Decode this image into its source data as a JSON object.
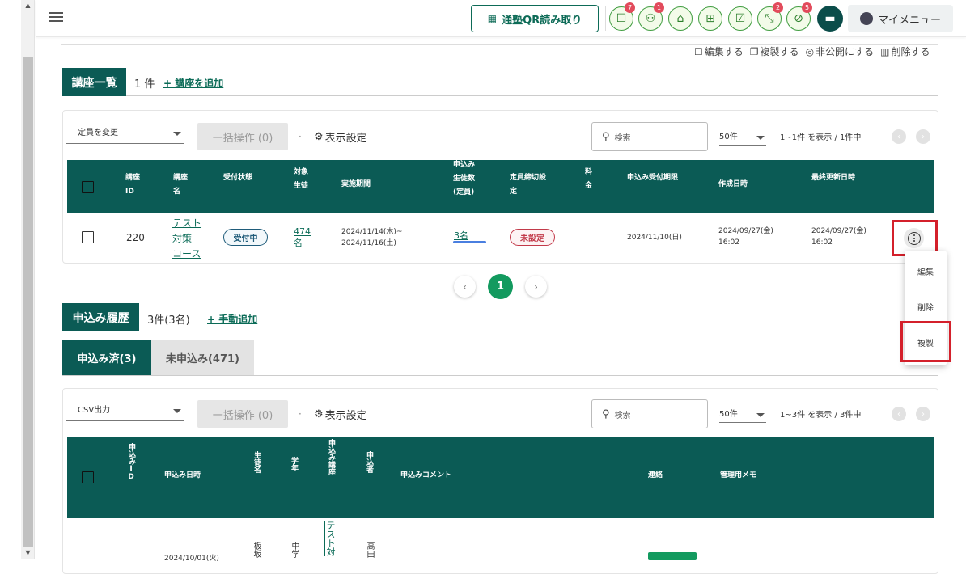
{
  "header": {
    "qr_button": "通塾QR読み取り",
    "icons": [
      {
        "name": "chat-bubble-icon",
        "glyph": "☐",
        "badge": "7"
      },
      {
        "name": "students-icon",
        "glyph": "⚇",
        "badge": "1"
      },
      {
        "name": "school-icon",
        "glyph": "⌂",
        "badge": ""
      },
      {
        "name": "gift-icon",
        "glyph": "⊞",
        "badge": ""
      },
      {
        "name": "checklist-icon",
        "glyph": "☑",
        "badge": ""
      },
      {
        "name": "shrink-icon",
        "glyph": "⤡",
        "badge": "2"
      },
      {
        "name": "no-location-icon",
        "glyph": "⊘",
        "badge": "5"
      }
    ],
    "my_menu": "マイメニュー"
  },
  "top_actions": {
    "edit": "編集する",
    "copy": "複製する",
    "hide": "非公開にする",
    "delete": "削除する"
  },
  "courses": {
    "section_title": "講座一覧",
    "count": "1 件",
    "add_link": "+ 講座を追加",
    "toolbar": {
      "select": "定員を変更",
      "bulk": "一括操作 (0)",
      "dot": "·",
      "display_settings": "表示設定",
      "search_placeholder": "検索",
      "per_page": "50件",
      "range": "1~1件 を表示 / 1件中"
    },
    "headers": {
      "id": [
        "講座",
        "ID"
      ],
      "name": [
        "講座",
        "名"
      ],
      "status": "受付状態",
      "target": [
        "対象",
        "生徒"
      ],
      "period": "実施期間",
      "applicants": [
        "申込み",
        "生徒数",
        "(定員)"
      ],
      "deadline_setting": [
        "定員締切設",
        "定"
      ],
      "fee": [
        "料",
        "金"
      ],
      "app_deadline": "申込み受付期限",
      "created": "作成日時",
      "updated": "最終更新日時"
    },
    "rows": [
      {
        "id": "220",
        "name_lines": [
          "テスト",
          "対策",
          "コース"
        ],
        "status": "受付中",
        "target_lines": [
          "474",
          "名"
        ],
        "period_lines": [
          "2024/11/14(木)~",
          "2024/11/16(土)"
        ],
        "applicants": "3名",
        "deadline_setting": "未設定",
        "app_deadline": "2024/11/10(日)",
        "created_lines": [
          "2024/09/27(金)",
          "16:02"
        ],
        "updated_lines": [
          "2024/09/27(金)",
          "16:02"
        ]
      }
    ],
    "context_menu": [
      "編集",
      "削除",
      "複製"
    ],
    "pagination": {
      "current": "1"
    }
  },
  "applications": {
    "section_title": "申込み履歴",
    "count": "3件(3名)",
    "add_link": "+ 手動追加",
    "tabs": [
      "申込み済(3)",
      "未申込み(471)"
    ],
    "toolbar": {
      "select": "CSV出力",
      "bulk": "一括操作 (0)",
      "dot": "·",
      "display_settings": "表示設定",
      "search_placeholder": "検索",
      "per_page": "50件",
      "range": "1~3件 を表示 / 3件中"
    },
    "headers": {
      "id": "申込みID",
      "datetime": "申込み日時",
      "student": "生徒名",
      "grade": "学年",
      "course": "申込み講座",
      "applicant": "申込者",
      "comment": "申込みコメント",
      "contact": "連絡",
      "memo": "管理用メモ"
    },
    "row_partial": {
      "datetime": "2024/10/01(火)",
      "student": "板坂",
      "grade": "中学",
      "course": "テスト対",
      "applicant": "高田"
    }
  }
}
